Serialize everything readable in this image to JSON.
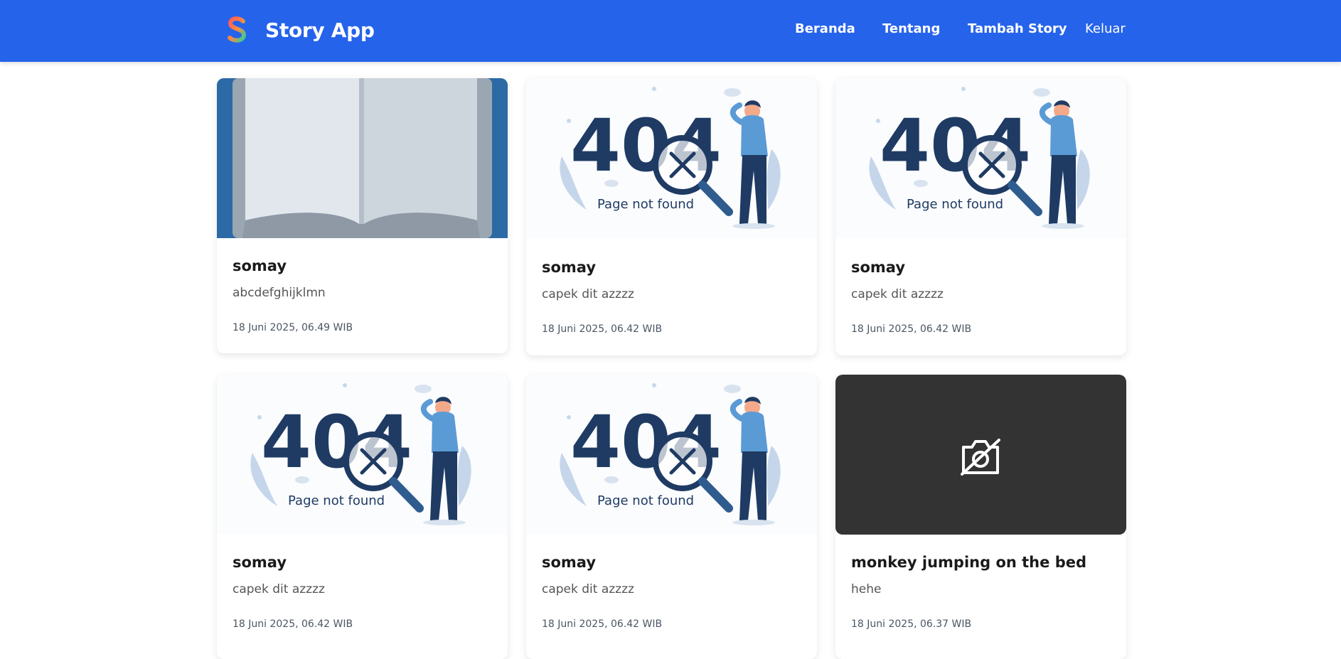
{
  "header": {
    "app_name": "Story App",
    "nav": [
      {
        "label": "Beranda"
      },
      {
        "label": "Tentang"
      },
      {
        "label": "Tambah Story"
      },
      {
        "label": "Keluar"
      }
    ]
  },
  "stories": [
    {
      "media": "book-image",
      "title": "somay",
      "description": "abcdefghijklmn",
      "date": "18 Juni 2025, 06.49 WIB"
    },
    {
      "media": "404-illustration",
      "media_text_big": "404",
      "media_text_small": "Page not found",
      "title": "somay",
      "description": "capek dit azzzz",
      "date": "18 Juni 2025, 06.42 WIB"
    },
    {
      "media": "404-illustration",
      "media_text_big": "404",
      "media_text_small": "Page not found",
      "title": "somay",
      "description": "capek dit azzzz",
      "date": "18 Juni 2025, 06.42 WIB"
    },
    {
      "media": "404-illustration",
      "media_text_big": "404",
      "media_text_small": "Page not found",
      "title": "somay",
      "description": "capek dit azzzz",
      "date": "18 Juni 2025, 06.42 WIB"
    },
    {
      "media": "404-illustration",
      "media_text_big": "404",
      "media_text_small": "Page not found",
      "title": "somay",
      "description": "capek dit azzzz",
      "date": "18 Juni 2025, 06.42 WIB"
    },
    {
      "media": "no-camera-icon",
      "title": "monkey jumping on the bed",
      "description": "hehe",
      "date": "18 Juni 2025, 06.37 WIB"
    }
  ],
  "colors": {
    "header_bg": "#2563eb",
    "illustration_navy": "#1f3b63",
    "illustration_blue": "#5b9bd5",
    "no_image_bg": "#333333"
  }
}
